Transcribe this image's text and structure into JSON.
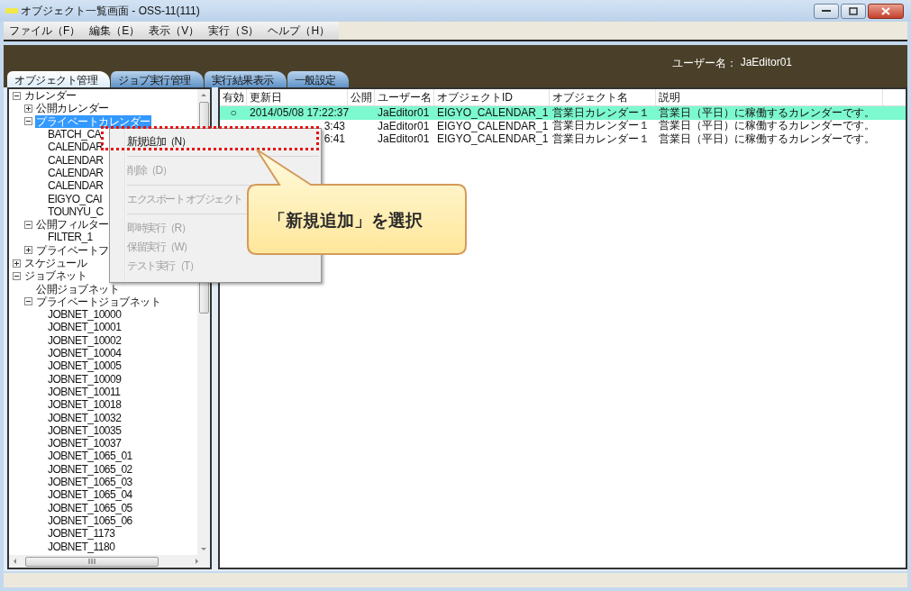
{
  "window": {
    "title": "オブジェクト一覧画面 - OSS-11(111)"
  },
  "menu_bar": [
    "ファイル（F）",
    "編集（E）",
    "表示（V）",
    "実行（S）",
    "ヘルプ（H）"
  ],
  "user": {
    "label": "ユーザー名：",
    "name": "JaEditor01"
  },
  "tabs": [
    {
      "label": "オブジェクト管理",
      "selected": true
    },
    {
      "label": "ジョブ実行管理",
      "selected": false
    },
    {
      "label": "実行結果表示",
      "selected": false
    },
    {
      "label": "一般設定",
      "selected": false
    }
  ],
  "tree": [
    {
      "label": "カレンダー",
      "expanded": true,
      "selected": false,
      "children": [
        {
          "label": "公開カレンダー",
          "expanded": false,
          "selected": false
        },
        {
          "label": "プライベートカレンダー",
          "expanded": true,
          "selected": true,
          "children": [
            {
              "label": "BATCH_CA",
              "selected": false
            },
            {
              "label": "CALENDAR",
              "selected": false
            },
            {
              "label": "CALENDAR",
              "selected": false
            },
            {
              "label": "CALENDAR",
              "selected": false
            },
            {
              "label": "CALENDAR",
              "selected": false
            },
            {
              "label": "EIGYO_CAI",
              "selected": false
            },
            {
              "label": "TOUNYU_C",
              "selected": false
            }
          ]
        },
        {
          "label": "公開フィルター",
          "expanded": true,
          "selected": false,
          "children": [
            {
              "label": "FILTER_1",
              "selected": false
            }
          ]
        },
        {
          "label": "プライベートフ",
          "expanded": false,
          "selected": false
        }
      ]
    },
    {
      "label": "スケジュール",
      "expanded": false,
      "selected": false
    },
    {
      "label": "ジョブネット",
      "expanded": true,
      "selected": false,
      "children": [
        {
          "label": "公開ジョブネット",
          "selected": false
        },
        {
          "label": "プライベートジョブネット",
          "expanded": true,
          "selected": false,
          "children": [
            {
              "label": "JOBNET_10000",
              "selected": false
            },
            {
              "label": "JOBNET_10001",
              "selected": false
            },
            {
              "label": "JOBNET_10002",
              "selected": false
            },
            {
              "label": "JOBNET_10004",
              "selected": false
            },
            {
              "label": "JOBNET_10005",
              "selected": false
            },
            {
              "label": "JOBNET_10009",
              "selected": false
            },
            {
              "label": "JOBNET_10011",
              "selected": false
            },
            {
              "label": "JOBNET_10018",
              "selected": false
            },
            {
              "label": "JOBNET_10032",
              "selected": false
            },
            {
              "label": "JOBNET_10035",
              "selected": false
            },
            {
              "label": "JOBNET_10037",
              "selected": false
            },
            {
              "label": "JOBNET_1065_01",
              "selected": false
            },
            {
              "label": "JOBNET_1065_02",
              "selected": false
            },
            {
              "label": "JOBNET_1065_03",
              "selected": false
            },
            {
              "label": "JOBNET_1065_04",
              "selected": false
            },
            {
              "label": "JOBNET_1065_05",
              "selected": false
            },
            {
              "label": "JOBNET_1065_06",
              "selected": false
            },
            {
              "label": "JOBNET_1173",
              "selected": false
            },
            {
              "label": "JOBNET_1180",
              "selected": false
            }
          ]
        }
      ]
    }
  ],
  "table": {
    "columns": [
      "有効",
      "更新日",
      "公開",
      "ユーザー名",
      "オブジェクトID",
      "オブジェクト名",
      "説明"
    ],
    "rows": [
      {
        "selected": true,
        "cells": [
          "○",
          "2014/05/08 17:22:37",
          "",
          "JaEditor01",
          "EIGYO_CALENDAR_1",
          "営業日カレンダー１",
          "営業日（平日）に稼働するカレンダーです。"
        ]
      },
      {
        "selected": false,
        "cells": [
          "",
          "3:43",
          "",
          "JaEditor01",
          "EIGYO_CALENDAR_1",
          "営業日カレンダー１",
          "営業日（平日）に稼働するカレンダーです。"
        ]
      },
      {
        "selected": false,
        "cells": [
          "",
          "6:41",
          "",
          "JaEditor01",
          "EIGYO_CALENDAR_1",
          "営業日カレンダー１",
          "営業日（平日）に稼働するカレンダーです。"
        ]
      }
    ]
  },
  "context_menu": [
    {
      "kind": "item",
      "label": "新規追加（N）",
      "disabled": false
    },
    {
      "kind": "separator"
    },
    {
      "kind": "item",
      "label": "削除（D）",
      "disabled": true
    },
    {
      "kind": "separator"
    },
    {
      "kind": "item",
      "label": "エクスポート オブジェクト",
      "disabled": true
    },
    {
      "kind": "separator"
    },
    {
      "kind": "item",
      "label": "即時実行（R）",
      "disabled": true
    },
    {
      "kind": "item",
      "label": "保留実行（W）",
      "disabled": true
    },
    {
      "kind": "item",
      "label": "テスト実行（T）",
      "disabled": true
    }
  ],
  "callout": {
    "text": "「新規追加」を選択"
  }
}
